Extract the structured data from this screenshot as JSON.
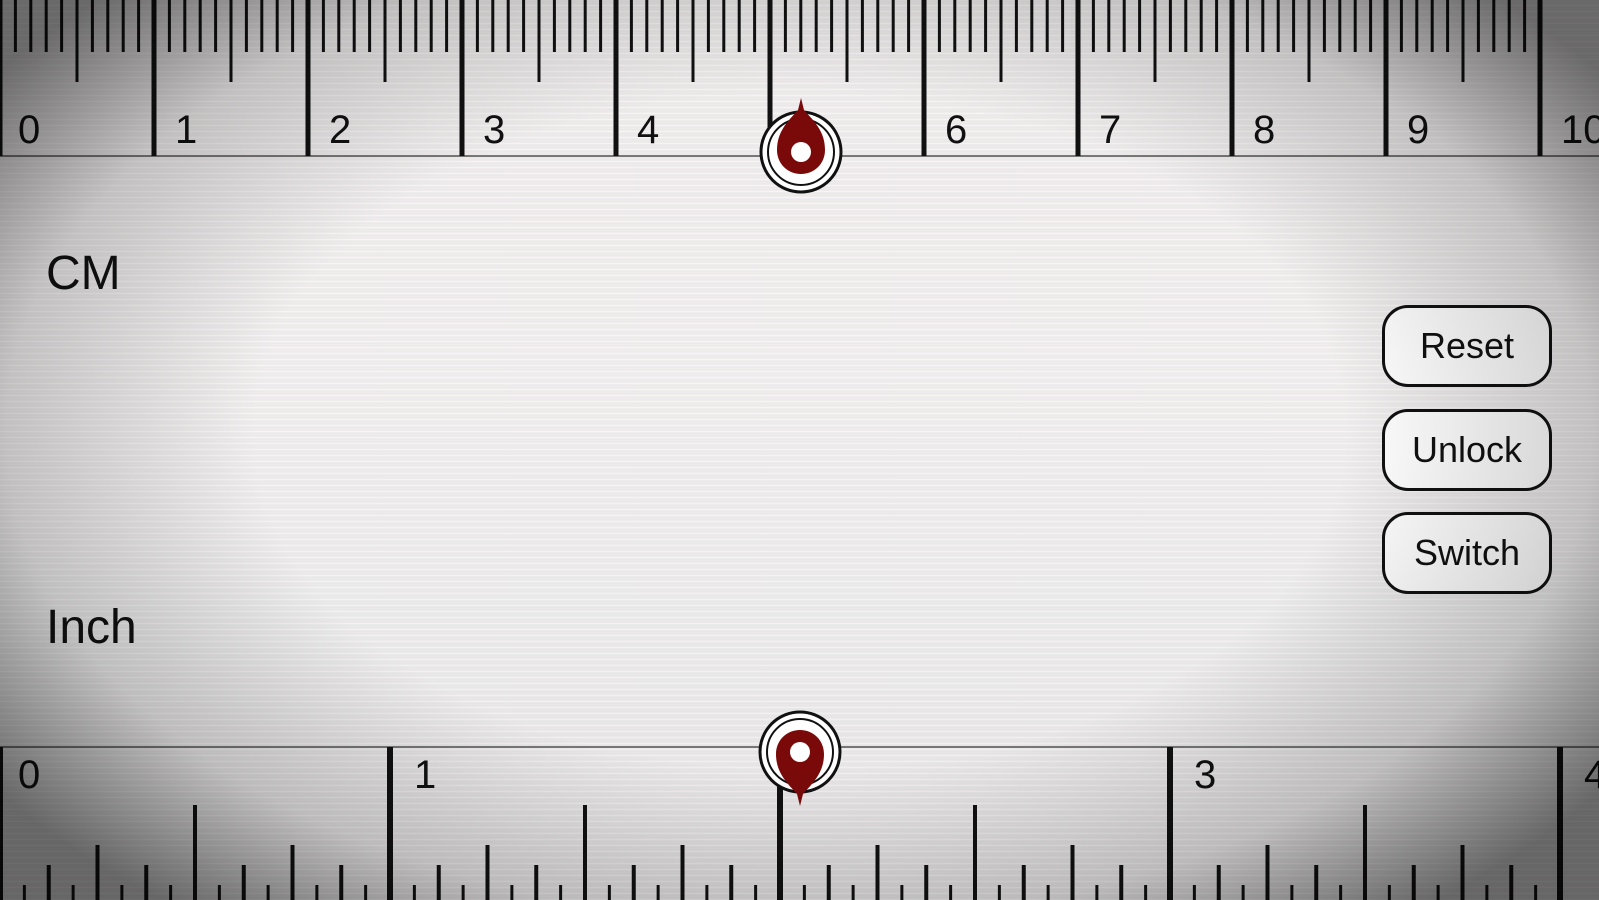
{
  "rulers": {
    "cm": {
      "label": "CM",
      "major_ticks": [
        "0",
        "1",
        "2",
        "3",
        "4",
        "5",
        "6",
        "7",
        "8",
        "9",
        "10"
      ],
      "visible_labels": [
        "0",
        "1",
        "2",
        "3",
        "4",
        "6",
        "7",
        "8",
        "9",
        "10"
      ],
      "marker_value": 5.2
    },
    "inch": {
      "label": "Inch",
      "major_ticks": [
        "0",
        "1",
        "2",
        "3",
        "4"
      ],
      "visible_labels": [
        "0",
        "1",
        "3",
        "4"
      ],
      "marker_value": 2.05
    }
  },
  "buttons": {
    "reset": "Reset",
    "unlock": "Unlock",
    "switch": "Switch"
  },
  "colors": {
    "marker": "#7a0a0a",
    "tick": "#111111",
    "button_bg": "#ffffff"
  },
  "icons": {
    "cm_marker": "pin-marker-icon",
    "inch_marker": "pin-marker-icon"
  }
}
